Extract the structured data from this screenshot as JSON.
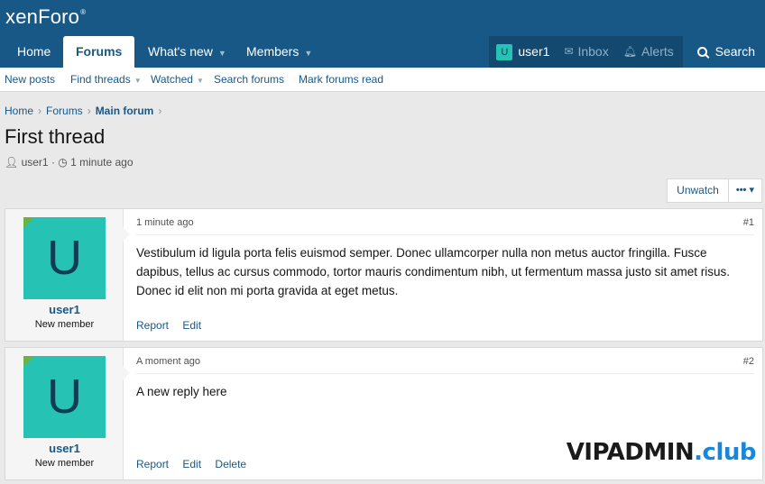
{
  "brand": {
    "logo_text": "xenForo",
    "logo_mark": "®"
  },
  "nav": {
    "tabs": [
      {
        "label": "Home"
      },
      {
        "label": "Forums"
      },
      {
        "label": "What's new"
      },
      {
        "label": "Members"
      }
    ],
    "account": {
      "avatar_letter": "U",
      "username": "user1"
    },
    "inbox": "Inbox",
    "alerts": "Alerts",
    "search": "Search"
  },
  "subnav": {
    "links": [
      {
        "label": "New posts"
      },
      {
        "label": "Find threads"
      },
      {
        "label": "Watched"
      },
      {
        "label": "Search forums"
      },
      {
        "label": "Mark forums read"
      }
    ]
  },
  "breadcrumb": {
    "items": [
      "Home",
      "Forums",
      "Main forum"
    ]
  },
  "thread": {
    "title": "First thread",
    "author": "user1",
    "separator": "·",
    "time": "1 minute ago",
    "unwatch_label": "Unwatch",
    "more_label": "•••"
  },
  "posts": [
    {
      "avatar_letter": "U",
      "username": "user1",
      "user_title": "New member",
      "time": "1 minute ago",
      "number": "#1",
      "body": "Vestibulum id ligula porta felis euismod semper. Donec ullamcorper nulla non metus auctor fringilla. Fusce dapibus, tellus ac cursus commodo, tortor mauris condimentum nibh, ut fermentum massa justo sit amet risus. Donec id elit non mi porta gravida at eget metus.",
      "actions": [
        "Report",
        "Edit"
      ]
    },
    {
      "avatar_letter": "U",
      "username": "user1",
      "user_title": "New member",
      "time": "A moment ago",
      "number": "#2",
      "body": "A new reply here",
      "actions": [
        "Report",
        "Edit",
        "Delete"
      ]
    }
  ],
  "watermark": {
    "main": "VIPADMIN",
    "suffix": ".club"
  },
  "colors": {
    "brand": "#185886",
    "avatar": "#26c2b4",
    "badge": "#6cb33f"
  }
}
